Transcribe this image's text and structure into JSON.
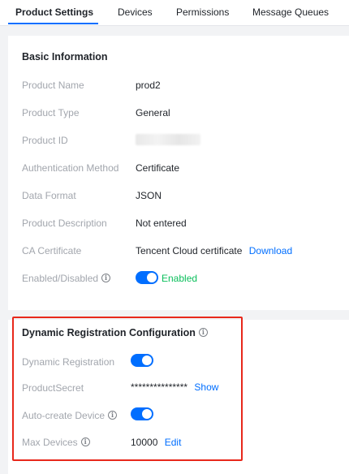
{
  "tabs": [
    {
      "label": "Product Settings"
    },
    {
      "label": "Devices"
    },
    {
      "label": "Permissions"
    },
    {
      "label": "Message Queues"
    }
  ],
  "basic_info": {
    "title": "Basic Information",
    "rows": [
      {
        "label": "Product Name",
        "value": "prod2"
      },
      {
        "label": "Product Type",
        "value": "General"
      },
      {
        "label": "Product ID",
        "value": ""
      },
      {
        "label": "Authentication Method",
        "value": "Certificate"
      },
      {
        "label": "Data Format",
        "value": "JSON"
      },
      {
        "label": "Product Description",
        "value": "Not entered"
      },
      {
        "label": "CA Certificate",
        "value": "Tencent Cloud certificate",
        "link": "Download"
      },
      {
        "label": "Enabled/Disabled",
        "value": "Enabled",
        "enabled": true
      }
    ]
  },
  "dynamic_registration": {
    "title": "Dynamic Registration Configuration",
    "rows": [
      {
        "label": "Dynamic Registration",
        "enabled": true
      },
      {
        "label": "ProductSecret",
        "value": "***************",
        "link": "Show"
      },
      {
        "label": "Auto-create Device",
        "enabled": true
      },
      {
        "label": "Max Devices",
        "value": "10000",
        "link": "Edit"
      }
    ]
  },
  "colors": {
    "accent": "#006eff",
    "enabled_text": "#0abf5b",
    "highlight": "#e8281b"
  },
  "icons": {
    "info": "info-circle-icon"
  }
}
